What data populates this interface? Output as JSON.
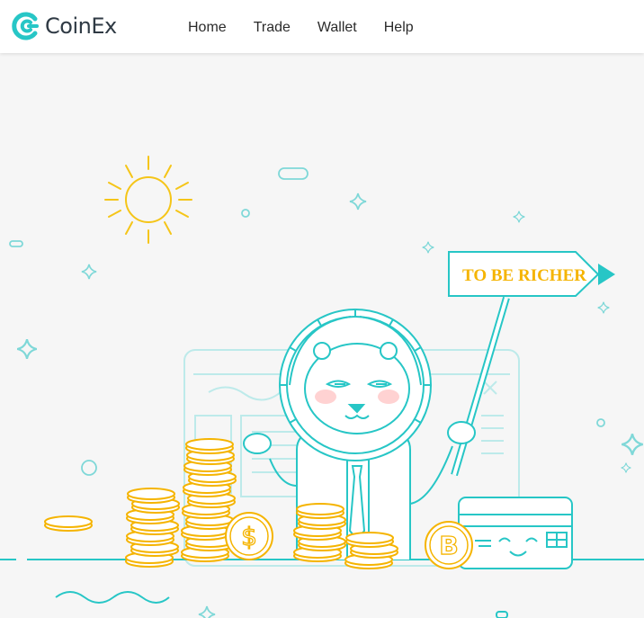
{
  "brand": {
    "name": "CoinEx",
    "logo_icon": "coinex-logo-icon"
  },
  "nav": {
    "items": [
      "Home",
      "Trade",
      "Wallet",
      "Help"
    ]
  },
  "hero": {
    "sign_text": "TO BE RICHER",
    "coin_symbols": {
      "dollar": "$",
      "bitcoin": "B"
    }
  },
  "colors": {
    "teal": "#27c6c6",
    "gold": "#f5b400",
    "blush": "#ffc7c7",
    "light_teal": "#bdeaea"
  }
}
